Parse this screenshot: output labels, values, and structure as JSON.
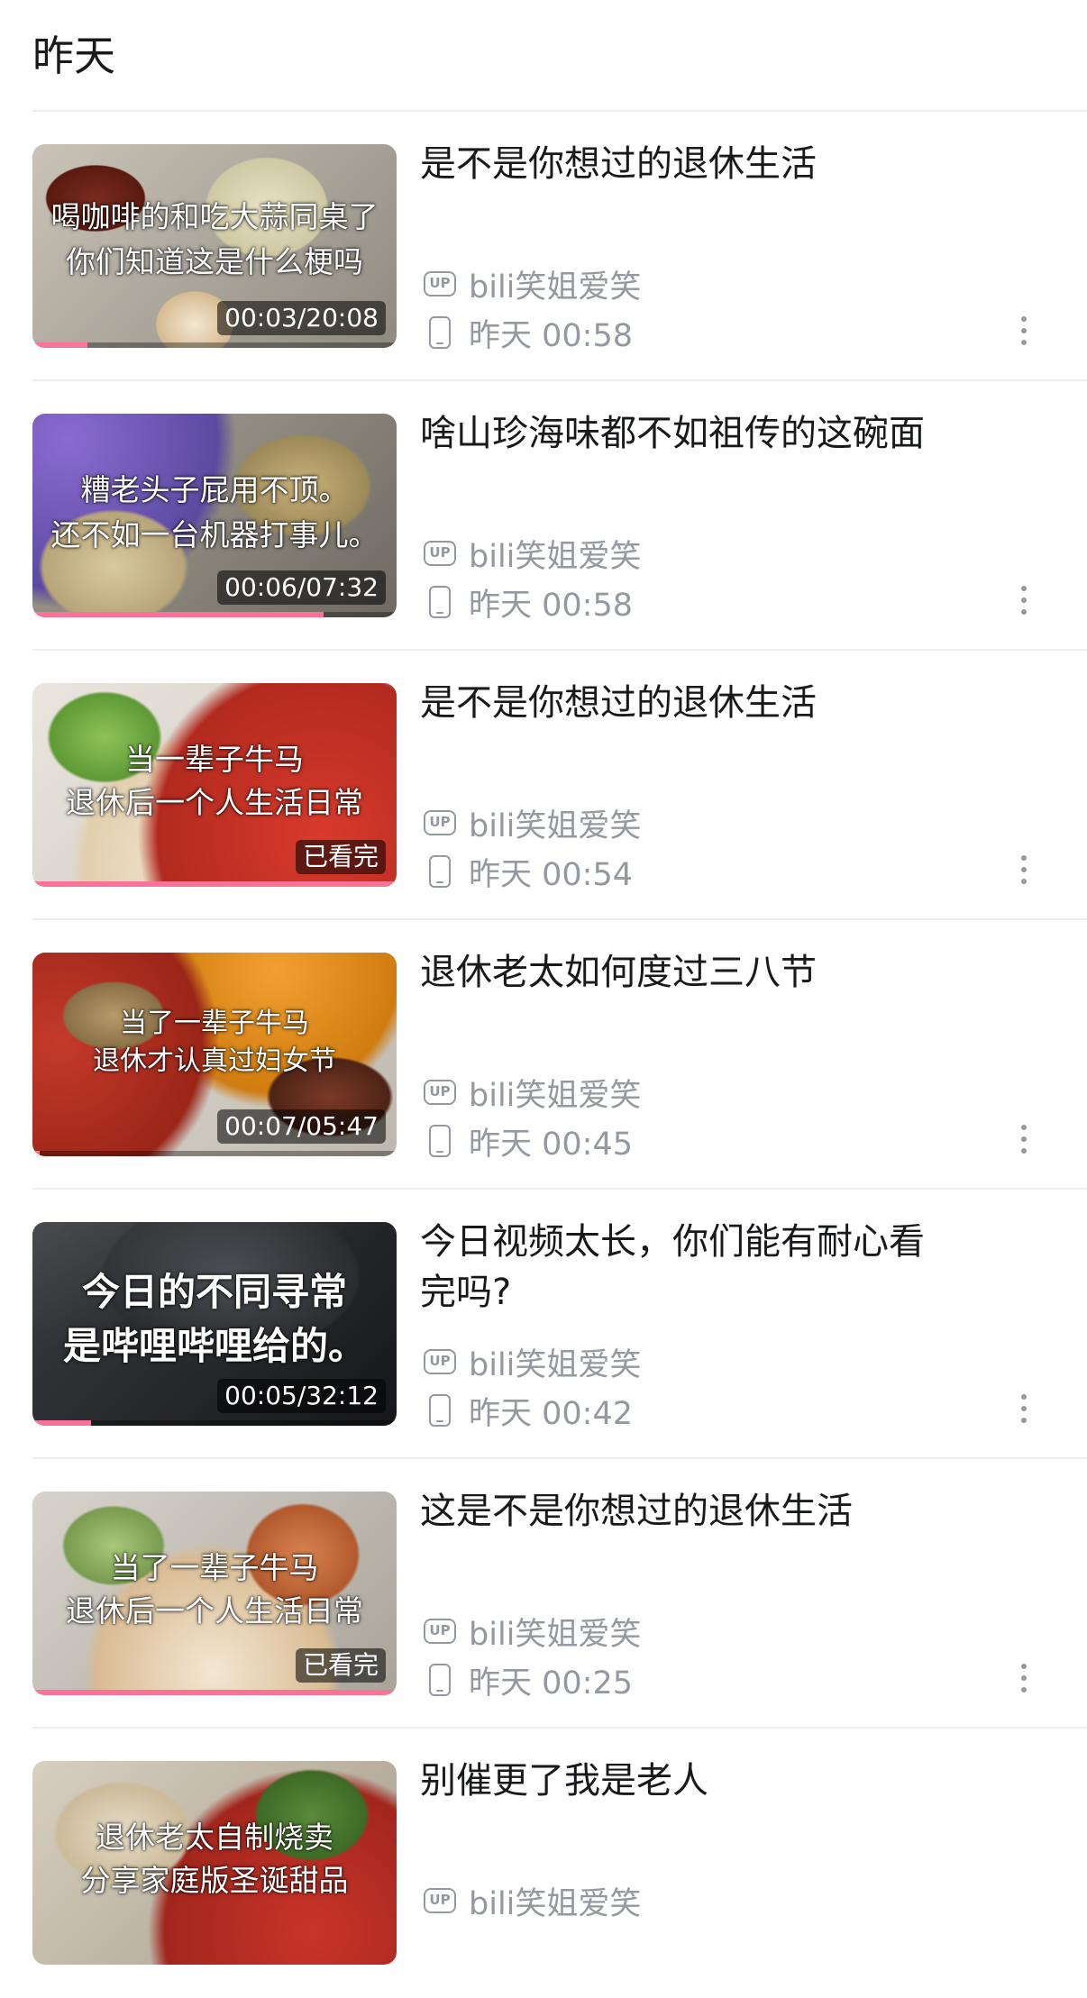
{
  "section": {
    "title": "昨天"
  },
  "colors": {
    "accent": "#fb7299",
    "meta_text": "#9499a0",
    "title_text": "#18191c",
    "divider": "#eeeeee"
  },
  "items": [
    {
      "title_line1": "是不是你想过的退休生活",
      "title_line2": "",
      "uploader": "bili笑姐爱笑",
      "time": "昨天 00:58",
      "thumb_line1": "喝咖啡的和吃大蒜同桌了",
      "thumb_line2": "你们知道这是什么梗吗",
      "badge": "00:03/20:08",
      "progress": 0.15
    },
    {
      "title_line1": "啥山珍海味都不如祖传的这碗面",
      "title_line2": "",
      "uploader": "bili笑姐爱笑",
      "time": "昨天 00:58",
      "thumb_line1": "糟老头子屁用不顶。",
      "thumb_line2": "还不如一台机器打事儿。",
      "badge": "00:06/07:32",
      "progress": 0.8
    },
    {
      "title_line1": "是不是你想过的退休生活",
      "title_line2": "",
      "uploader": "bili笑姐爱笑",
      "time": "昨天 00:54",
      "thumb_line1": "当一辈子牛马",
      "thumb_line2": "退休后一个人生活日常",
      "badge": "已看完",
      "progress": 1.0
    },
    {
      "title_line1": "退休老太如何度过三八节",
      "title_line2": "",
      "uploader": "bili笑姐爱笑",
      "time": "昨天 00:45",
      "thumb_line1": "当了一辈子牛马",
      "thumb_line2": "退休才认真过妇女节",
      "badge": "00:07/05:47",
      "progress": 0.02
    },
    {
      "title_line1": "今日视频太长，你们能有耐心看",
      "title_line2": "完吗?",
      "uploader": "bili笑姐爱笑",
      "time": "昨天 00:42",
      "thumb_line1": "今日的不同寻常",
      "thumb_line2": "是哔哩哔哩给的。",
      "badge": "00:05/32:12",
      "progress": 0.16
    },
    {
      "title_line1": "这是不是你想过的退休生活",
      "title_line2": "",
      "uploader": "bili笑姐爱笑",
      "time": "昨天 00:25",
      "thumb_line1": "当了一辈子牛马",
      "thumb_line2": "退休后一个人生活日常",
      "badge": "已看完",
      "progress": 1.0
    },
    {
      "title_line1": "别催更了我是老人",
      "title_line2": "",
      "uploader": "bili笑姐爱笑",
      "time": "",
      "thumb_line1": "退休老太自制烧卖",
      "thumb_line2": "分享家庭版圣诞甜品",
      "badge": "",
      "progress": 0
    }
  ],
  "icons": {
    "uploader": "up-badge-icon",
    "device": "phone-icon",
    "more": "more-vertical-icon"
  },
  "up_label": "UP"
}
